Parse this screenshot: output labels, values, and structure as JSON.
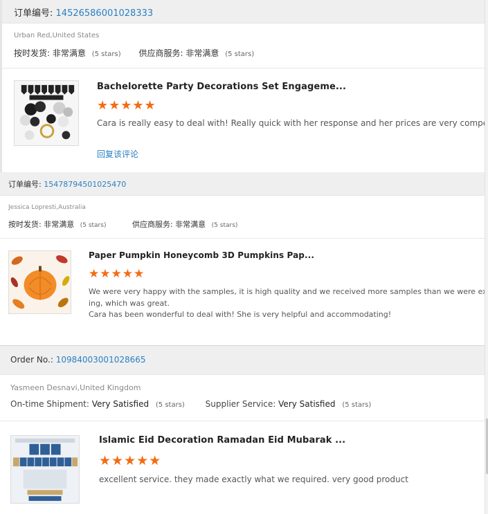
{
  "orders": [
    {
      "order_label": "订单编号:",
      "order_number": "14526586001028333",
      "buyer": "Urban Red,United States",
      "shipment_label": "按时发货:",
      "shipment_value": "非常满意",
      "shipment_stars": "(5 stars)",
      "service_label": "供应商服务:",
      "service_value": "非常满意",
      "service_stars": "(5 stars)",
      "product_title": "Bachelorette Party Decorations Set Engageme...",
      "rating": 5,
      "stars": "★★★★★",
      "review_lines": [
        "Cara is really easy to deal with! Really quick with her response and her prices are very competitive!"
      ],
      "reply_label": "回复该评论"
    },
    {
      "order_label": "订单编号:",
      "order_number": "15478794501025470",
      "buyer": "Jessica Lopresti,Australia",
      "shipment_label": "按时发货:",
      "shipment_value": "非常满意",
      "shipment_stars": "(5 stars)",
      "service_label": "供应商服务:",
      "service_value": "非常满意",
      "service_stars": "(5 stars)",
      "product_title": "Paper Pumpkin Honeycomb 3D Pumpkins Pap...",
      "rating": 5,
      "stars": "★★★★★",
      "review_lines": [
        "We were very happy with the samples, it is high quality and we received more samples than we were exp",
        "ing, which was great.",
        "Cara has been wonderful to deal with! She is very helpful and accommodating!"
      ]
    },
    {
      "order_label": "Order No.:",
      "order_number": "10984003001028665",
      "buyer": "Yasmeen Desnavi,United Kingdom",
      "shipment_label": "On-time Shipment:",
      "shipment_value": "Very Satisfied",
      "shipment_stars": "(5 stars)",
      "service_label": "Supplier Service:",
      "service_value": "Very Satisfied",
      "service_stars": "(5 stars)",
      "product_title": "Islamic Eid Decoration Ramadan Eid Mubarak ...",
      "rating": 5,
      "stars": "★★★★★",
      "review_lines": [
        "excellent service. they made exactly what we required. very good product"
      ]
    }
  ],
  "icons": {
    "product_1": "bachelorette-decoration-thumbnail",
    "product_2": "paper-pumpkin-thumbnail",
    "product_3": "eid-banner-thumbnail"
  },
  "colors": {
    "link": "#2a7fc2",
    "star": "#f36c12",
    "header_bg": "#efefef"
  }
}
